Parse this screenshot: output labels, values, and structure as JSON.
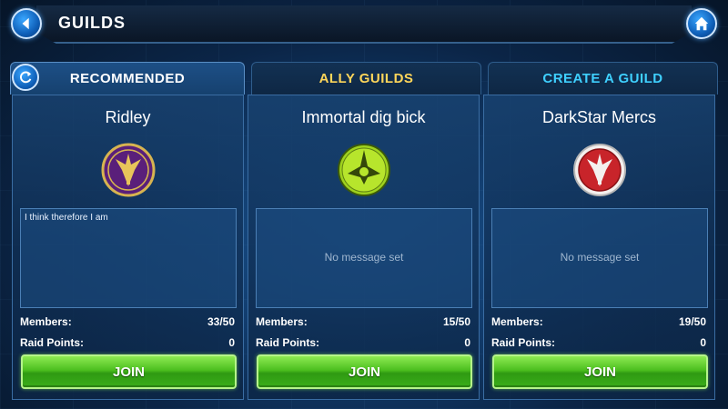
{
  "header": {
    "title": "GUILDS",
    "back_icon": "back-arrow-icon",
    "home_icon": "home-icon"
  },
  "tabs": [
    {
      "label": "RECOMMENDED",
      "active": true,
      "color": "#ffffff"
    },
    {
      "label": "ALLY GUILDS",
      "active": false,
      "color": "#ffd65a"
    },
    {
      "label": "CREATE A GUILD",
      "active": false,
      "color": "#3fd0ff"
    }
  ],
  "refresh_icon": "refresh-icon",
  "labels": {
    "members": "Members:",
    "raid_points": "Raid Points:",
    "join": "JOIN"
  },
  "guilds": [
    {
      "name": "Ridley",
      "emblem": "old-republic-emblem-purple",
      "message": "I think therefore I am",
      "members": "33/50",
      "raid_points": "0"
    },
    {
      "name": "Immortal dig bick",
      "emblem": "rebel-ship-emblem-green",
      "message": "No message set",
      "members": "15/50",
      "raid_points": "0"
    },
    {
      "name": "DarkStar Mercs",
      "emblem": "old-republic-emblem-red",
      "message": "No message set",
      "members": "19/50",
      "raid_points": "0"
    }
  ],
  "colors": {
    "join_button": "#4cbf1f",
    "panel": "#184270",
    "accent_blue": "#3aa7ff"
  }
}
